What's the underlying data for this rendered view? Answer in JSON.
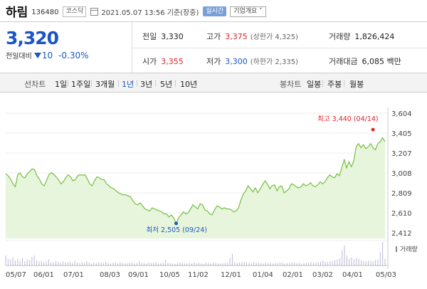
{
  "header": {
    "name": "하림",
    "code": "136480",
    "market": "코스닥",
    "datetime": "2021.05.07 13:56  기준(장중)",
    "realtime_label": "실시간",
    "overview_label": "기업개요 ˅"
  },
  "price": {
    "current": "3,320",
    "change_label": "전일대비",
    "change_value": "10",
    "change_pct": "-0.30%",
    "prev_label": "전일",
    "prev": "3,330",
    "high_label": "고가",
    "high": "3,375",
    "upper_limit": "(상한가 4,325)",
    "volume_label": "거래량",
    "volume": "1,826,424",
    "open_label": "시가",
    "open": "3,355",
    "low_label": "저가",
    "low": "3,300",
    "lower_limit": "(하한가 2,335)",
    "amount_label": "거래대금",
    "amount": "6,085",
    "amount_unit": "백만"
  },
  "periods": {
    "line_label": "선차트",
    "items": [
      "1일",
      "1주일",
      "3개월",
      "1년",
      "3년",
      "5년",
      "10년"
    ],
    "selected": "1년",
    "candle_label": "봉차트",
    "candles": [
      "일봉",
      "주봉",
      "월봉"
    ]
  },
  "colors": {
    "up": "#e0242c",
    "down": "#1a56c4",
    "line": "#7cc34a",
    "area": "#e8f5dd"
  },
  "chart_data": {
    "type": "area",
    "y_ticks": [
      "3,604",
      "3,405",
      "3,207",
      "3,008",
      "2,809",
      "2,610",
      "2,412"
    ],
    "ylim": [
      2412,
      3604
    ],
    "x_ticks": [
      "05/07",
      "06/01",
      "07/01",
      "08/03",
      "09/01",
      "10/05",
      "11/02",
      "12/01",
      "01/04",
      "02/01",
      "03/02",
      "04/01",
      "05/03"
    ],
    "max_annotation": "최고 3,440 (04/14)",
    "min_annotation": "최저 2,505 (09/24)",
    "volume_label": "거래량",
    "prices": [
      3000,
      2980,
      2950,
      2900,
      2870,
      2990,
      3010,
      2970,
      2960,
      3000,
      3020,
      3050,
      3040,
      2980,
      2950,
      2900,
      2880,
      2930,
      2990,
      3010,
      2995,
      2970,
      2940,
      2900,
      2920,
      2960,
      2990,
      2970,
      2930,
      2940,
      2980,
      2990,
      2985,
      2990,
      2950,
      2900,
      2880,
      2930,
      2970,
      2960,
      2945,
      2940,
      2900,
      2880,
      2860,
      2850,
      2830,
      2810,
      2800,
      2790,
      2790,
      2780,
      2770,
      2730,
      2700,
      2690,
      2710,
      2680,
      2650,
      2640,
      2630,
      2660,
      2650,
      2640,
      2630,
      2620,
      2600,
      2600,
      2570,
      2590,
      2560,
      2505,
      2560,
      2590,
      2620,
      2600,
      2610,
      2650,
      2690,
      2670,
      2650,
      2700,
      2690,
      2640,
      2630,
      2600,
      2590,
      2640,
      2680,
      2670,
      2650,
      2660,
      2650,
      2650,
      2640,
      2620,
      2630,
      2660,
      2740,
      2800,
      2830,
      2880,
      2850,
      2820,
      2860,
      2810,
      2850,
      2890,
      2930,
      2900,
      2850,
      2880,
      2890,
      2830,
      2870,
      2880,
      2810,
      2830,
      2850,
      2900,
      2890,
      2870,
      2860,
      2870,
      2900,
      2880,
      2890,
      2910,
      2880,
      2870,
      2890,
      2920,
      2900,
      2920,
      2960,
      2990,
      2970,
      2960,
      3000,
      2980,
      3060,
      3140,
      3060,
      3120,
      3070,
      3130,
      3270,
      3300,
      3260,
      3290,
      3250,
      3270,
      3300,
      3260,
      3240,
      3300,
      3320,
      3360,
      3320
    ],
    "volumes": [
      30,
      20,
      18,
      25,
      15,
      20,
      14,
      22,
      12,
      18,
      16,
      25,
      30,
      15,
      12,
      14,
      10,
      12,
      18,
      9,
      10,
      14,
      11,
      8,
      12,
      9,
      10,
      11,
      8,
      13,
      9,
      7,
      10,
      8,
      12,
      9,
      6,
      8,
      7,
      10,
      9,
      8,
      11,
      7,
      6,
      8,
      9,
      7,
      10,
      8,
      6,
      7,
      9,
      8,
      6,
      7,
      12,
      8,
      7,
      6,
      9,
      7,
      8,
      10,
      6,
      7,
      9,
      18,
      8,
      7,
      6,
      5,
      7,
      8,
      9,
      6,
      7,
      8,
      6,
      9,
      7,
      8,
      6,
      5,
      8,
      7,
      6,
      9,
      8,
      7,
      6,
      7,
      8,
      9,
      22,
      35,
      12,
      8,
      9,
      10,
      11,
      9,
      8,
      7,
      10,
      9,
      8,
      7,
      6,
      9,
      8,
      7,
      6,
      8,
      7,
      9,
      8,
      6,
      7,
      8,
      9,
      10,
      7,
      8,
      6,
      7,
      8,
      9,
      10,
      8,
      9,
      10,
      12,
      15,
      11,
      10,
      12,
      14,
      16,
      18,
      22,
      45,
      60,
      30,
      20,
      25,
      18,
      22,
      20,
      16,
      14,
      12,
      15,
      14,
      13,
      16,
      18,
      40,
      70,
      20
    ],
    "max_index": 153,
    "min_index": 71
  }
}
